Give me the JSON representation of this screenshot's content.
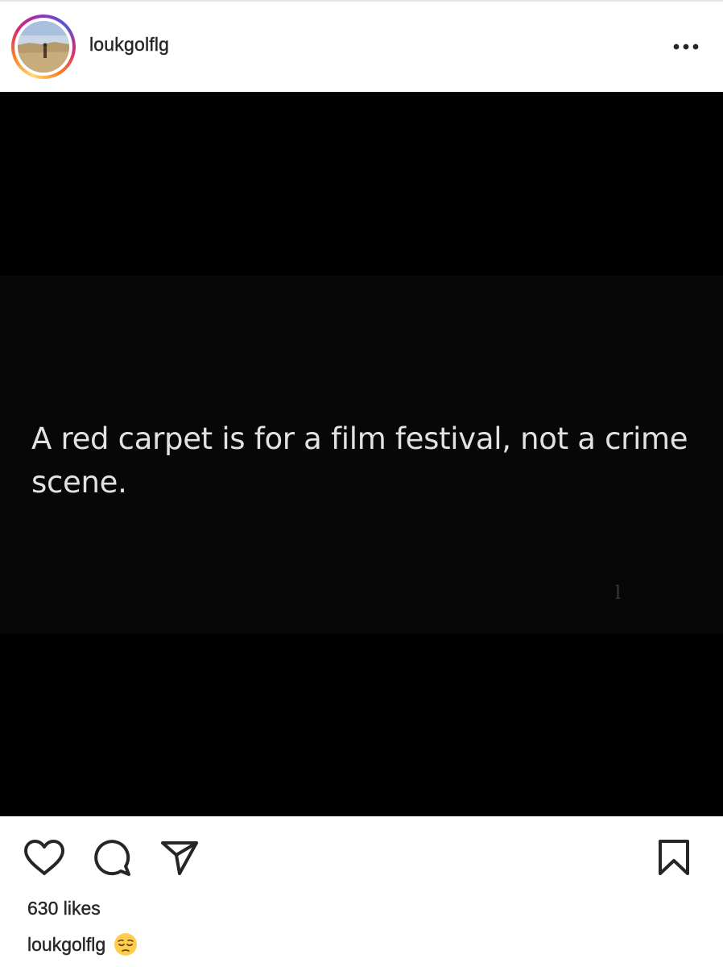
{
  "post": {
    "username": "loukgolflg",
    "more_icon": "more-horizontal-icon",
    "media_text": "A red carpet is for a film festival, not a crime scene.",
    "likes_label": "630 likes",
    "caption_user": "loukgolflg",
    "caption_emoji": "pensive-face-emoji"
  },
  "actions": {
    "like_icon": "heart-icon",
    "comment_icon": "comment-icon",
    "share_icon": "send-icon",
    "save_icon": "bookmark-icon"
  },
  "colors": {
    "text": "#262626",
    "media_background": "#000000",
    "overlay_text": "#e2e2e2"
  }
}
